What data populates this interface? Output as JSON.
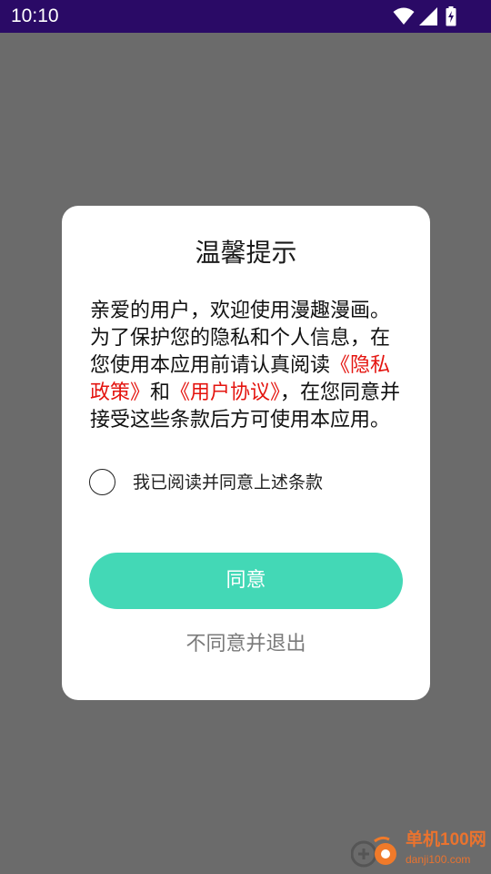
{
  "status_bar": {
    "time": "10:10",
    "icons": [
      "wifi-icon",
      "cellular-signal-icon",
      "battery-charging-icon"
    ]
  },
  "dialog": {
    "title": "温馨提示",
    "body": {
      "intro": "亲爱的用户，欢迎使用漫趣漫画。为了保护您的隐私和个人信息，在您使用本应用前请认真阅读",
      "privacy_link": "《隐私政策》",
      "and": "和",
      "user_agreement_link": "《用户协议》",
      "outro": "，在您同意并接受这些条款后方可使用本应用。"
    },
    "agree_checkbox": {
      "label": "我已阅读并同意上述条款",
      "checked": false
    },
    "agree_button": "同意",
    "decline_button": "不同意并退出"
  },
  "colors": {
    "status_bar": "#2a0a66",
    "overlay": "#6b6b6b",
    "accent": "#43d8b6",
    "link": "#e4140f"
  },
  "watermark": {
    "name": "单机100网",
    "url": "danji100.com"
  }
}
